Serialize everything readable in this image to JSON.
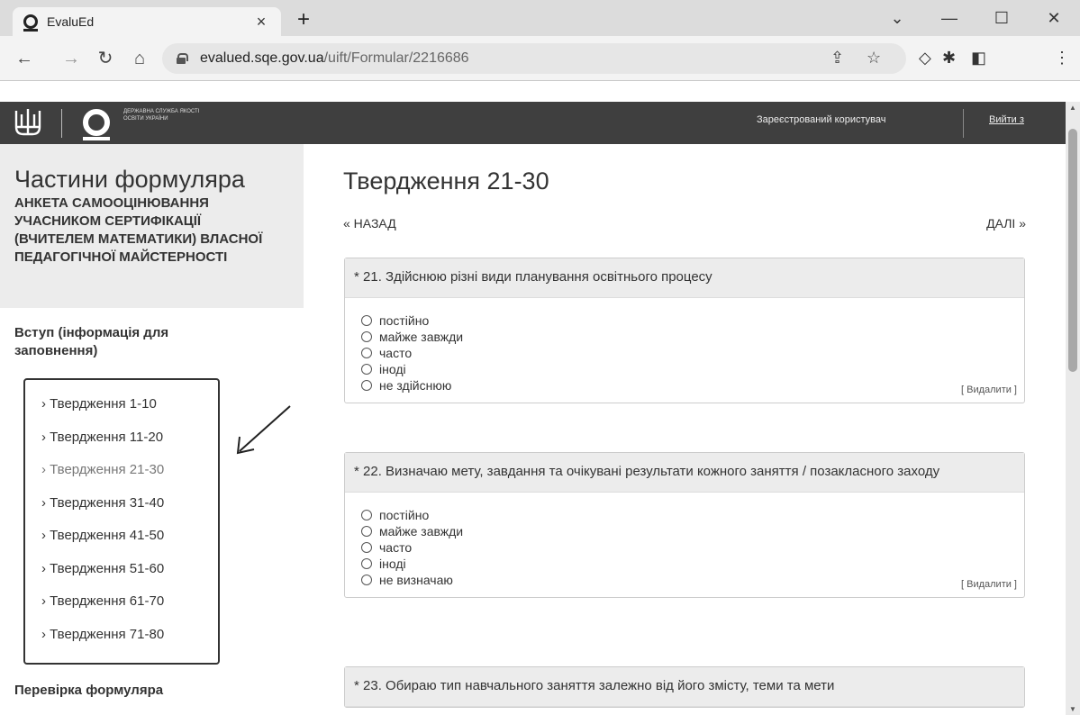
{
  "browser": {
    "tab_title": "EvaluEd",
    "tab_close": "×",
    "new_tab": "+",
    "url_domain": "evalued.sqe.gov.ua",
    "url_path": "/uift/Formular/2216686",
    "window_controls": {
      "menu": "⌄",
      "minimize": "—",
      "maximize": "☐",
      "close": "✕"
    },
    "nav": {
      "back": "←",
      "forward": "→",
      "reload": "↻",
      "home": "⌂"
    }
  },
  "header": {
    "logo_text": "ДЕРЖАВНА СЛУЖБА ЯКОСТІ ОСВІТИ УКРАЇНИ",
    "user_text": "Зареєстрований користувач",
    "logout": "Вийти з"
  },
  "sidebar": {
    "title": "Частини формуляра",
    "form_name": "АНКЕТА САМООЦІНЮВАННЯ УЧАСНИКОМ СЕРТИФІКАЦІЇ (ВЧИТЕЛЕМ МАТЕМАТИКИ) ВЛАСНОЇ ПЕДАГОГІЧНОЇ МАЙСТЕРНОСТІ",
    "intro": "Вступ (інформація для заповнення)",
    "items": [
      "› Твердження 1-10",
      "› Твердження 11-20",
      "› Твердження 21-30",
      "› Твердження 31-40",
      "› Твердження 41-50",
      "› Твердження 51-60",
      "› Твердження 61-70",
      "› Твердження 71-80"
    ],
    "check": "Перевірка формуляра"
  },
  "main": {
    "title": "Твердження 21-30",
    "back": "« НАЗАД",
    "next": "ДАЛІ »",
    "delete_label": "[ Видалити ]",
    "questions": [
      {
        "text": "* 21. Здійснюю різні види планування освітнього процесу",
        "options": [
          "постійно",
          "майже завжди",
          "часто",
          "іноді",
          "не здійснюю"
        ]
      },
      {
        "text": "* 22. Визначаю мету, завдання та очікувані результати кожного заняття / позакласного заходу",
        "options": [
          "постійно",
          "майже завжди",
          "часто",
          "іноді",
          "не визначаю"
        ]
      },
      {
        "text": "* 23. Обираю тип навчального заняття залежно від його змісту, теми та мети"
      }
    ]
  }
}
